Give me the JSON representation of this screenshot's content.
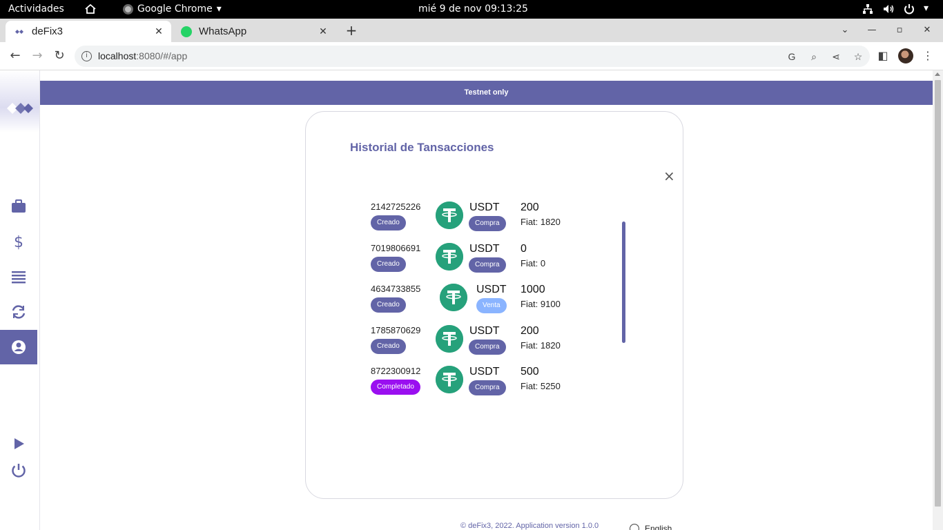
{
  "os_bar": {
    "activities": "Actividades",
    "app_name": "Google Chrome",
    "clock": "mié  9 de nov  09:13:25"
  },
  "browser": {
    "tabs": [
      {
        "title": "deFix3",
        "favicon": "defix-logo-icon"
      },
      {
        "title": "WhatsApp",
        "favicon": "whatsapp-icon"
      }
    ],
    "url_host": "localhost",
    "url_path": ":8080/#/app"
  },
  "app": {
    "banner": "Testnet only",
    "sidebar": [
      {
        "name": "briefcase-icon"
      },
      {
        "name": "dollar-icon"
      },
      {
        "name": "list-icon"
      },
      {
        "name": "swap-icon"
      },
      {
        "name": "account-icon",
        "active": true
      },
      {
        "name": "play-icon"
      },
      {
        "name": "power-icon"
      }
    ],
    "dialog": {
      "title": "Historial de Tansacciones",
      "close": "×"
    },
    "transactions": [
      {
        "id": "2142725226",
        "status": "Creado",
        "coin": "USDT",
        "side": "Compra",
        "amount": "200",
        "fiat": "Fiat: 1820"
      },
      {
        "id": "7019806691",
        "status": "Creado",
        "coin": "USDT",
        "side": "Compra",
        "amount": "0",
        "fiat": "Fiat: 0"
      },
      {
        "id": "4634733855",
        "status": "Creado",
        "coin": "USDT",
        "side": "Venta",
        "amount": "1000",
        "fiat": "Fiat: 9100"
      },
      {
        "id": "1785870629",
        "status": "Creado",
        "coin": "USDT",
        "side": "Compra",
        "amount": "200",
        "fiat": "Fiat: 1820"
      },
      {
        "id": "8722300912",
        "status": "Completado",
        "coin": "USDT",
        "side": "Compra",
        "amount": "500",
        "fiat": "Fiat: 5250"
      }
    ],
    "footer": "© deFix3, 2022. Application version 1.0.0",
    "language": "English"
  },
  "colors": {
    "accent": "#6264a7",
    "tether": "#26a17b",
    "completed": "#9a0ff0",
    "sell": "#8ab4ff"
  }
}
